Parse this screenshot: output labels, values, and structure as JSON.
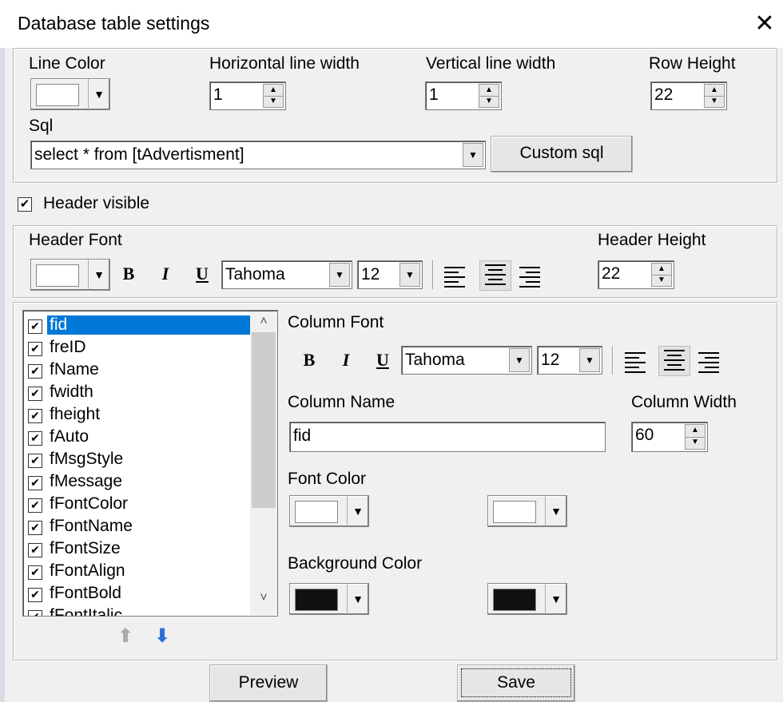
{
  "window": {
    "title": "Database table settings",
    "close_glyph": "✕"
  },
  "grid": {
    "line_color_label": "Line Color",
    "hline_width_label": "Horizontal line width",
    "hline_width": "1",
    "vline_width_label": "Vertical line width",
    "vline_width": "1",
    "row_height_label": "Row Height",
    "row_height": "22",
    "line_color": "#ffffff"
  },
  "sql": {
    "label": "Sql",
    "value": "select * from [tAdvertisment]",
    "custom_button": "Custom sql"
  },
  "header_visible": {
    "label": "Header visible",
    "checked": true
  },
  "header": {
    "font_label": "Header Font",
    "height_label": "Header Height",
    "height": "22",
    "font_name": "Tahoma",
    "font_size": "12",
    "bold": "B",
    "italic": "I",
    "underline": "U",
    "color": "#ffffff"
  },
  "columns": {
    "items": [
      "fid",
      "freID",
      "fName",
      "fwidth",
      "fheight",
      "fAuto",
      "fMsgStyle",
      "fMessage",
      "fFontColor",
      "fFontName",
      "fFontSize",
      "fFontAlign",
      "fFontBold",
      "fFontItalic"
    ],
    "selected": "fid",
    "font_label": "Column Font",
    "font_name": "Tahoma",
    "font_size": "12",
    "bold": "B",
    "italic": "I",
    "underline": "U",
    "name_label": "Column Name",
    "name_value": "fid",
    "width_label": "Column Width",
    "width_value": "60",
    "font_color_label": "Font Color",
    "bg_color_label": "Background Color",
    "font_colors": [
      "#ffffff",
      "#ffffff"
    ],
    "bg_colors": [
      "#111111",
      "#111111"
    ]
  },
  "footer": {
    "preview_button": "Preview",
    "save_button": "Save"
  }
}
